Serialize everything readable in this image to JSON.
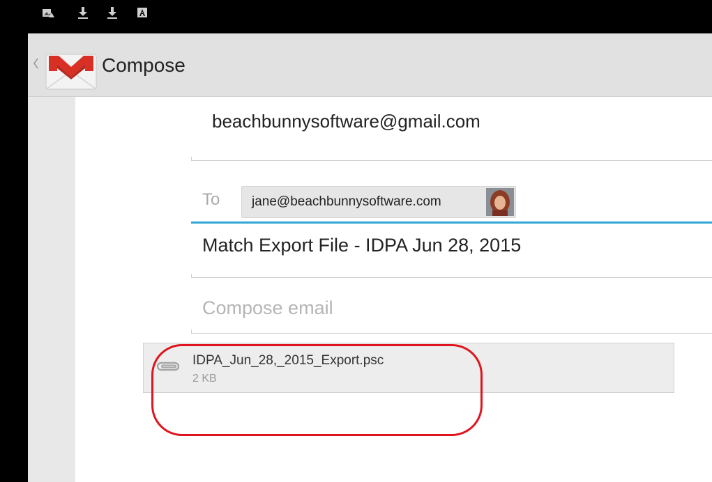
{
  "status_bar": {
    "icons": [
      "photo-notification-icon",
      "download-icon",
      "download-icon",
      "keyboard-a-icon"
    ]
  },
  "action_bar": {
    "title": "Compose",
    "logo_icon": "gmail-envelope-icon",
    "up_icon": "up-caret-icon"
  },
  "compose": {
    "from": "beachbunnysoftware@gmail.com",
    "to_label": "To",
    "to_recipients": [
      {
        "email": "jane@beachbunnysoftware.com",
        "avatar_icon": "contact-photo"
      }
    ],
    "subject": "Match Export File - IDPA Jun 28, 2015",
    "body_placeholder": "Compose email"
  },
  "attachment": {
    "filename": "IDPA_Jun_28,_2015_Export.psc",
    "size": "2 KB",
    "icon": "paperclip-icon"
  },
  "colors": {
    "focus_accent": "#33a5d6",
    "highlight_annotation": "#e0141e",
    "gmail_red": "#d93025"
  }
}
